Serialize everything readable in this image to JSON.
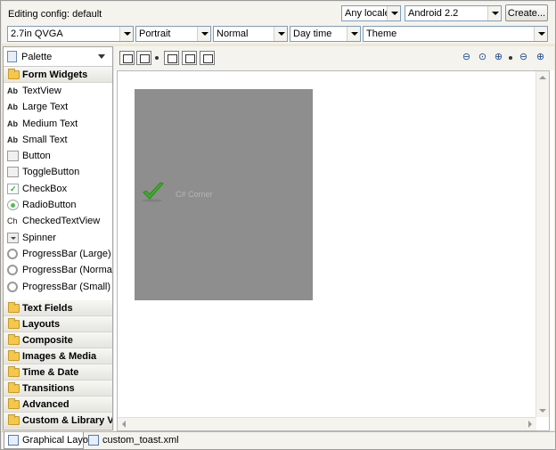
{
  "header": {
    "editing_config_label": "Editing config:",
    "editing_config_value": "default",
    "locale_select": "Any locale",
    "platform_select": "Android 2.2",
    "create_button": "Create..."
  },
  "config_bar": {
    "screen_select": "2.7in QVGA",
    "orientation_select": "Portrait",
    "dock_select": "Normal",
    "time_select": "Day time",
    "theme_select": "Theme"
  },
  "palette": {
    "title": "Palette",
    "form_widgets": {
      "label": "Form Widgets",
      "items": [
        {
          "label": "TextView",
          "icon": "Ab"
        },
        {
          "label": "Large Text",
          "icon": "Ab"
        },
        {
          "label": "Medium Text",
          "icon": "Ab"
        },
        {
          "label": "Small Text",
          "icon": "Ab"
        },
        {
          "label": "Button",
          "icon": "button-widget-icon"
        },
        {
          "label": "ToggleButton",
          "icon": "toggle-widget-icon"
        },
        {
          "label": "CheckBox",
          "icon": "checkbox-widget-icon"
        },
        {
          "label": "RadioButton",
          "icon": "radio-widget-icon"
        },
        {
          "label": "CheckedTextView",
          "icon": "Ch"
        },
        {
          "label": "Spinner",
          "icon": "spinner-widget-icon"
        },
        {
          "label": "ProgressBar (Large)",
          "icon": "progress-widget-icon"
        },
        {
          "label": "ProgressBar (Normal)",
          "icon": "progress-widget-icon"
        },
        {
          "label": "ProgressBar (Small)",
          "icon": "progress-widget-icon"
        }
      ]
    },
    "categories": [
      "Text Fields",
      "Layouts",
      "Composite",
      "Images & Media",
      "Time & Date",
      "Transitions",
      "Advanced",
      "Custom & Library View"
    ]
  },
  "canvas": {
    "toast_text": "C# Corner"
  },
  "tabs": {
    "graphical_layout": "Graphical Layout",
    "xml_file": "custom_toast.xml"
  },
  "colors": {
    "device_background": "#8e8e8e",
    "check_green": "#3fae2a",
    "chrome_background": "#f4f3ee"
  }
}
